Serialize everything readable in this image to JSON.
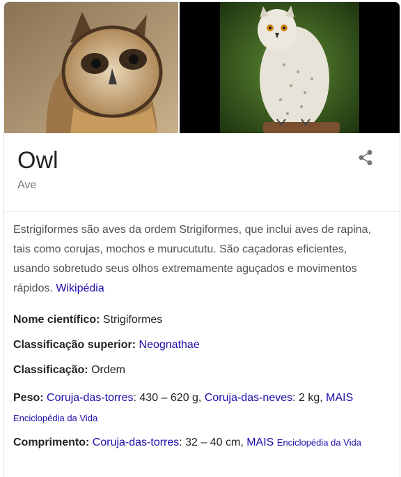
{
  "panel": {
    "title": "Owl",
    "subtitle": "Ave",
    "description": "Estrigiformes são aves da ordem Strigiformes, que inclui aves de rapina, tais como corujas, mochos e murucututu. São caçadoras eficientes, usando sobretudo seus olhos extremamente aguçados e movimentos rápidos.",
    "description_source": "Wikipédia"
  },
  "facts": {
    "scientific_name": {
      "label": "Nome científico:",
      "value": "Strigiformes"
    },
    "superior_class": {
      "label": "Classificação superior:",
      "value": "Neognathae"
    },
    "classification": {
      "label": "Classificação:",
      "value": "Ordem"
    },
    "weight": {
      "label": "Peso:",
      "item1_link": "Coruja-das-torres",
      "item1_value": ": 430 – 620 g, ",
      "item2_link": "Coruja-das-neves",
      "item2_value": ": 2 kg,",
      "more": "MAIS",
      "source": "Enciclopédia da Vida"
    },
    "length": {
      "label": "Comprimento:",
      "item1_link": "Coruja-das-torres",
      "item1_value": ": 32 – 40 cm, ",
      "more": "MAIS",
      "source": "Enciclopédia da Vida"
    }
  },
  "icons": {
    "share": "share-icon"
  },
  "colors": {
    "link": "#1a0dab",
    "muted": "#70757a",
    "text": "#222222"
  }
}
